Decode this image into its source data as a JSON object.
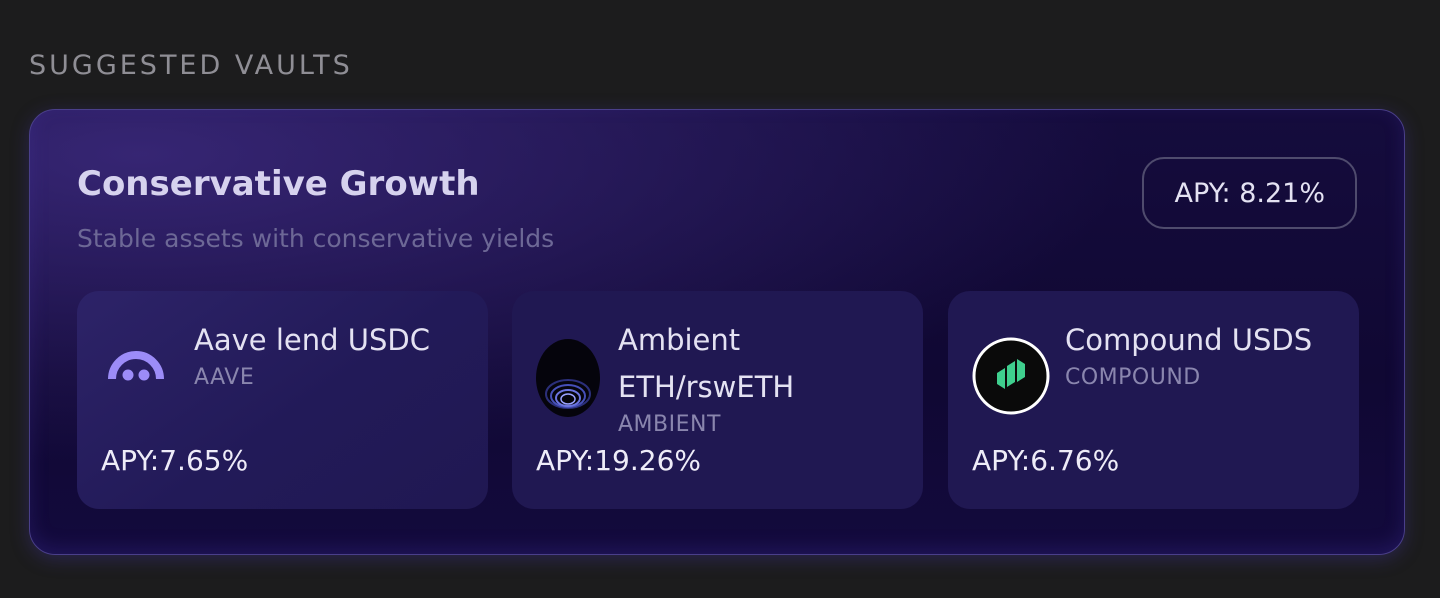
{
  "section": {
    "heading": "SUGGESTED VAULTS"
  },
  "vault": {
    "title": "Conservative Growth",
    "subtitle": "Stable assets with conservative yields",
    "apy_label": "APY: 8.21%",
    "strategies": [
      {
        "name": "Aave lend USDC",
        "protocol": "AAVE",
        "apy_label": "APY:7.65%",
        "icon": "aave-logo-icon",
        "color": "#9c8cf8"
      },
      {
        "name": "Ambient ETH/rswETH",
        "protocol": "AMBIENT",
        "apy_label": "APY:19.26%",
        "icon": "ambient-logo-icon",
        "color": "#6b68d6"
      },
      {
        "name": "Compound USDS",
        "protocol": "COMPOUND",
        "apy_label": "APY:6.76%",
        "icon": "compound-logo-icon",
        "color": "#3fcf8e"
      }
    ]
  },
  "colors": {
    "background": "#1c1c1d",
    "card": "#130b3c",
    "strategy_card": "#201852",
    "accent_border": "#4a3f8a"
  }
}
